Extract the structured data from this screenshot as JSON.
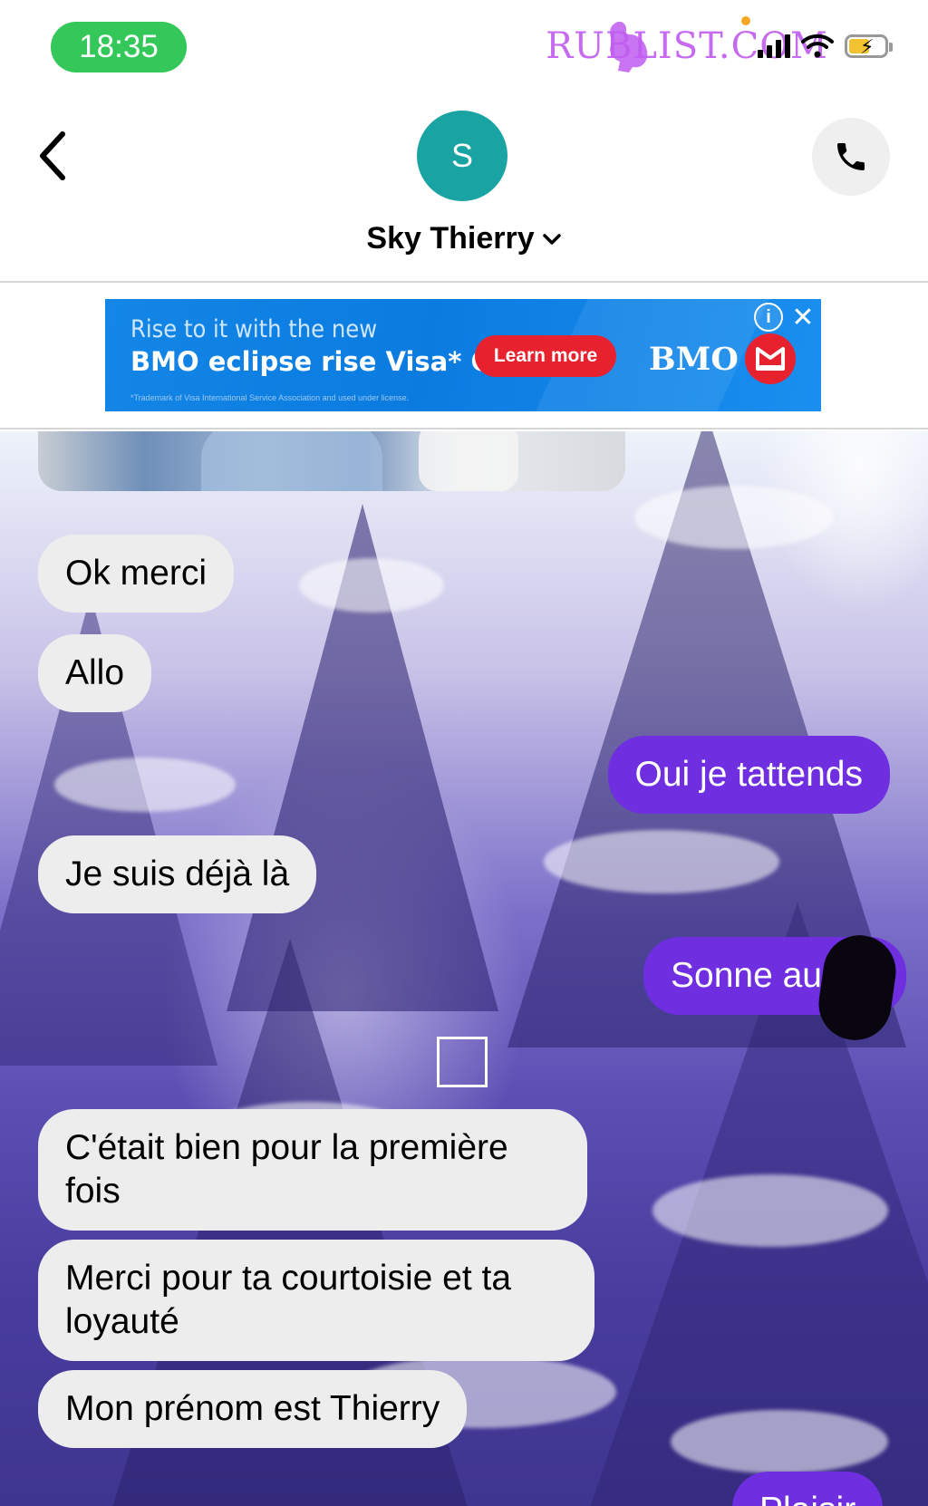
{
  "status_bar": {
    "time": "18:35",
    "watermark": "RUBLIST.COM",
    "icons": [
      "cellular-signal-icon",
      "wifi-icon",
      "battery-charging-icon"
    ],
    "colors": {
      "time_pill": "#34c759",
      "watermark": "#c05cf0"
    }
  },
  "header": {
    "avatar_initial": "S",
    "contact_name": "Sky Thierry",
    "icons": [
      "back-chevron-icon",
      "chevron-down-icon",
      "phone-icon"
    ],
    "colors": {
      "avatar": "#1aa3a3"
    }
  },
  "ad": {
    "line1": "Rise to it with the new",
    "line2": "BMO eclipse rise Visa* Card.",
    "fine_print": "*Trademark of Visa International Service Association and used under license.",
    "cta": "Learn more",
    "brand": "BMO",
    "info_symbol": "i",
    "close_symbol": "✕",
    "colors": {
      "banner": "#0b7be0",
      "cta": "#e8212f"
    }
  },
  "messages": [
    {
      "direction": "in",
      "text": "Ok merci"
    },
    {
      "direction": "in",
      "text": "Allo"
    },
    {
      "direction": "out",
      "text": "Oui je tattends"
    },
    {
      "direction": "in",
      "text": "Je suis déjà là"
    },
    {
      "direction": "out",
      "text": "Sonne au"
    },
    {
      "direction": "in",
      "text": "C'était bien pour la première fois"
    },
    {
      "direction": "in",
      "text": "Merci pour ta courtoisie et ta loyauté"
    },
    {
      "direction": "in",
      "text": "Mon prénom est Thierry"
    },
    {
      "direction": "out",
      "text": "Plaisir"
    }
  ],
  "colors": {
    "incoming_bubble": "#ededed",
    "outgoing_bubble": "#6f2ee0"
  }
}
